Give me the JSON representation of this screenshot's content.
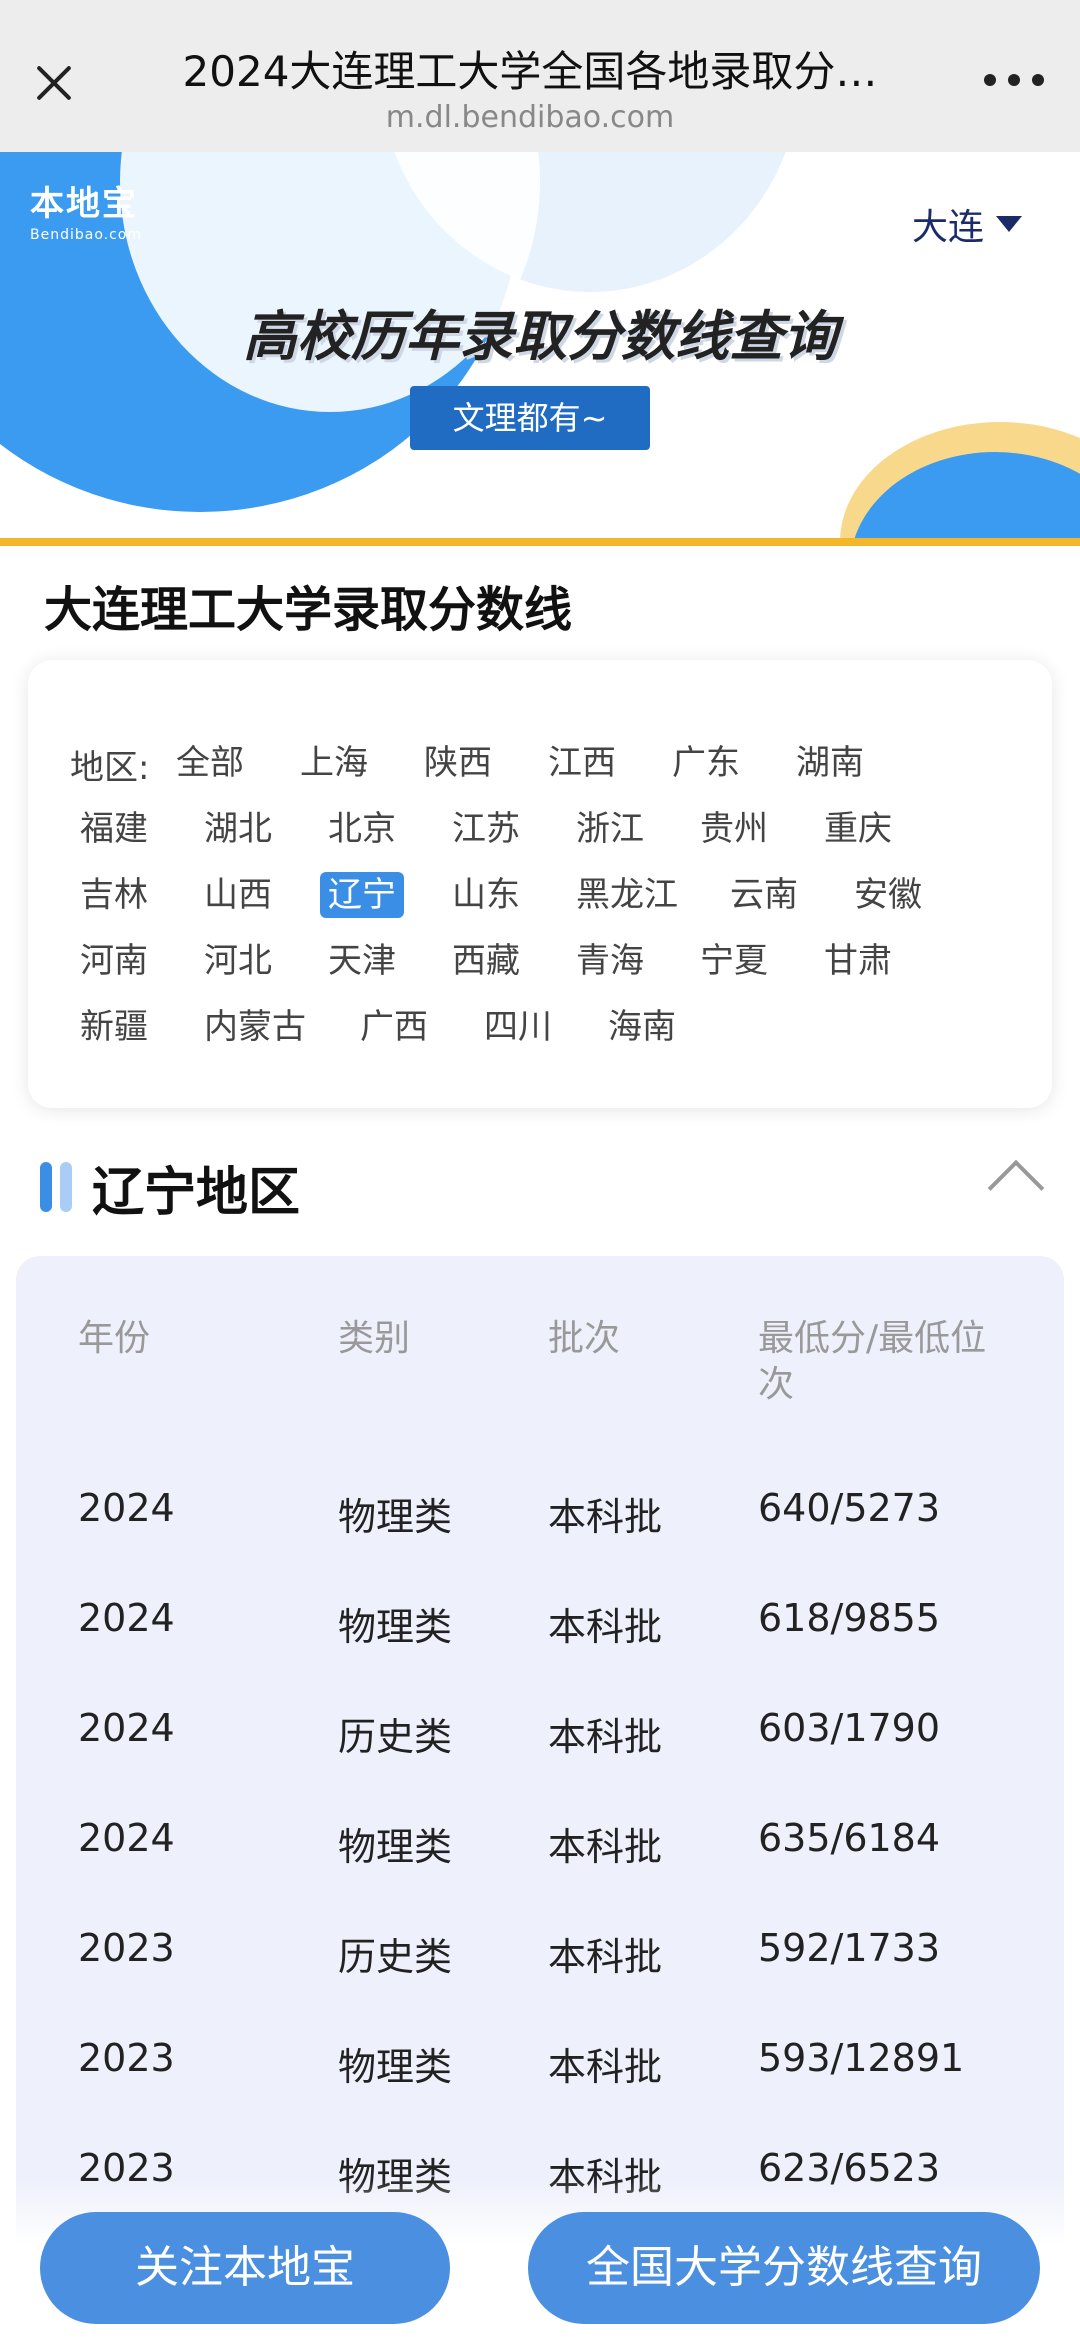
{
  "topbar": {
    "title": "2024大连理工大学全国各地录取分…",
    "url": "m.dl.bendibao.com"
  },
  "banner": {
    "logo_cn": "本地宝",
    "logo_en": "Bendibao.com",
    "city": "大连",
    "title": "高校历年录取分数线查询",
    "button": "文理都有~"
  },
  "section_title": "大连理工大学录取分数线",
  "regions": {
    "label": "地区:",
    "items": [
      "全部",
      "上海",
      "陕西",
      "江西",
      "广东",
      "湖南",
      "福建",
      "湖北",
      "北京",
      "江苏",
      "浙江",
      "贵州",
      "重庆",
      "吉林",
      "山西",
      "辽宁",
      "山东",
      "黑龙江",
      "云南",
      "安徽",
      "河南",
      "河北",
      "天津",
      "西藏",
      "青海",
      "宁夏",
      "甘肃",
      "新疆",
      "内蒙古",
      "广西",
      "四川",
      "海南"
    ],
    "selected": "辽宁"
  },
  "region_heading": "辽宁地区",
  "table": {
    "headers": [
      "年份",
      "类别",
      "批次",
      "最低分/最低位次"
    ],
    "rows": [
      [
        "2024",
        "物理类",
        "本科批",
        "640/5273"
      ],
      [
        "2024",
        "物理类",
        "本科批",
        "618/9855"
      ],
      [
        "2024",
        "历史类",
        "本科批",
        "603/1790"
      ],
      [
        "2024",
        "物理类",
        "本科批",
        "635/6184"
      ],
      [
        "2023",
        "历史类",
        "本科批",
        "592/1733"
      ],
      [
        "2023",
        "物理类",
        "本科批",
        "593/12891"
      ],
      [
        "2023",
        "物理类",
        "本科批",
        "623/6523"
      ]
    ]
  },
  "bottom": {
    "follow": "关注本地宝",
    "query": "全国大学分数线查询"
  },
  "colors": {
    "accent": "#3a8ee6",
    "banner_line": "#f4b62a",
    "table_bg": "#eef0fb"
  }
}
